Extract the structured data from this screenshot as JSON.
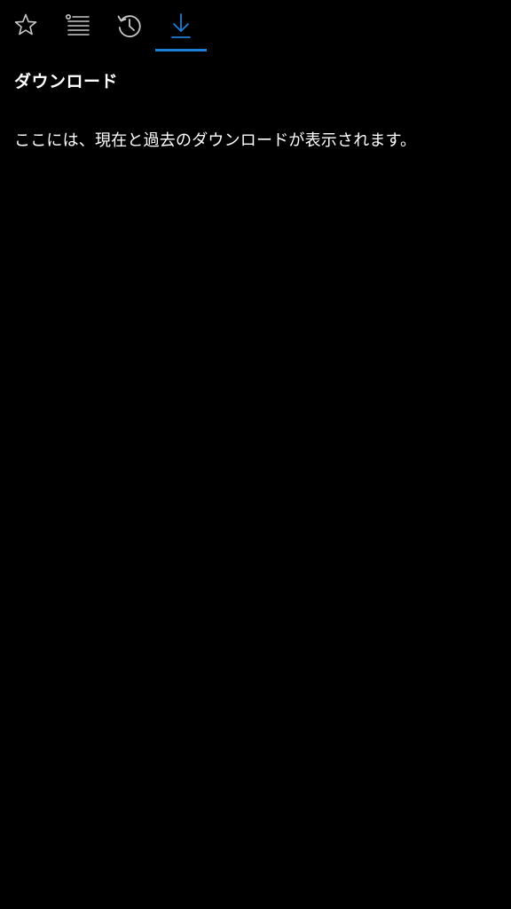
{
  "tabs": [
    {
      "id": "favorites",
      "icon": "star-icon",
      "selected": false
    },
    {
      "id": "reading-list",
      "icon": "reading-list-icon",
      "selected": false
    },
    {
      "id": "history",
      "icon": "history-icon",
      "selected": false
    },
    {
      "id": "downloads",
      "icon": "download-icon",
      "selected": true
    }
  ],
  "colors": {
    "background": "#000000",
    "icon_inactive": "#c8c8c8",
    "accent": "#1e7fd8",
    "text": "#ffffff"
  },
  "downloads": {
    "title": "ダウンロード",
    "empty_message": "ここには、現在と過去のダウンロードが表示されます。"
  }
}
